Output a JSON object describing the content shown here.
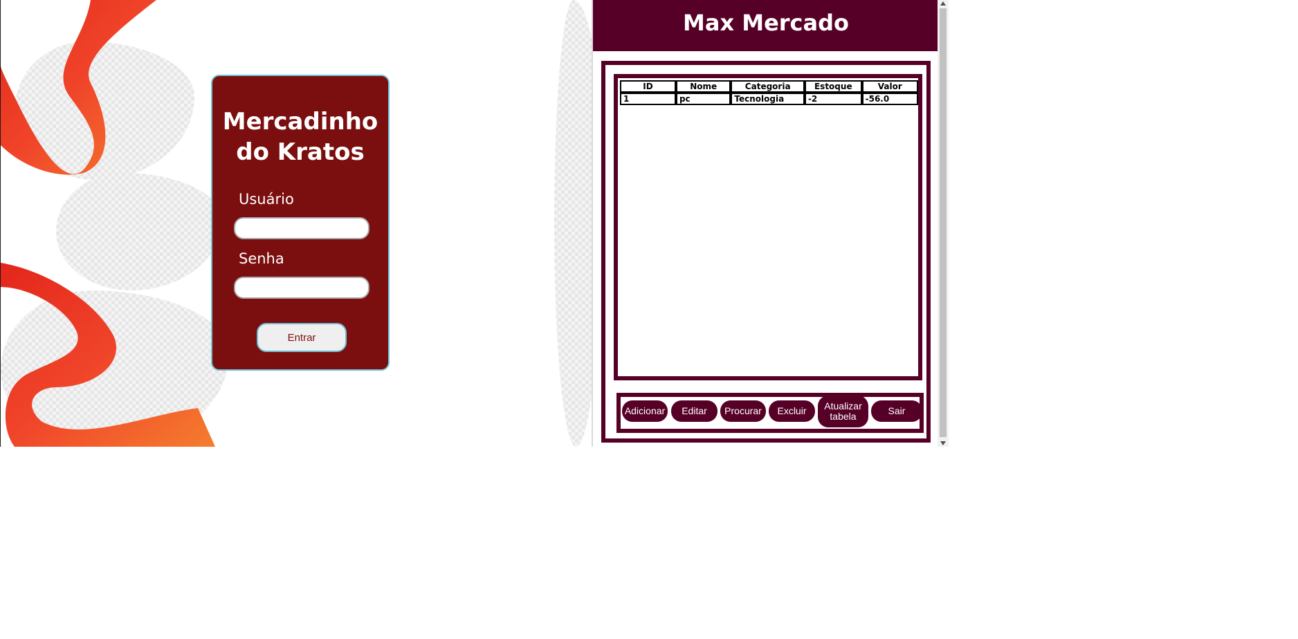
{
  "login": {
    "title_line1": "Mercadinho",
    "title_line2": "do Kratos",
    "user_label": "Usuário",
    "password_label": "Senha",
    "user_value": "",
    "password_value": "",
    "enter_label": "Entrar"
  },
  "store": {
    "title": "Max Mercado",
    "table": {
      "columns": [
        "ID",
        "Nome",
        "Categoria",
        "Estoque",
        "Valor"
      ],
      "rows": [
        [
          "1",
          "pc",
          "Tecnologia",
          "-2",
          "-56.0"
        ]
      ]
    },
    "buttons": {
      "add": "Adicionar",
      "edit": "Editar",
      "search": "Procurar",
      "delete": "Excluir",
      "refresh_line1": "Atualizar",
      "refresh_line2": "tabela",
      "exit": "Sair"
    }
  },
  "colors": {
    "login_bg": "#7b0e0e",
    "store_accent": "#570027",
    "login_border": "#6fc3d6"
  }
}
